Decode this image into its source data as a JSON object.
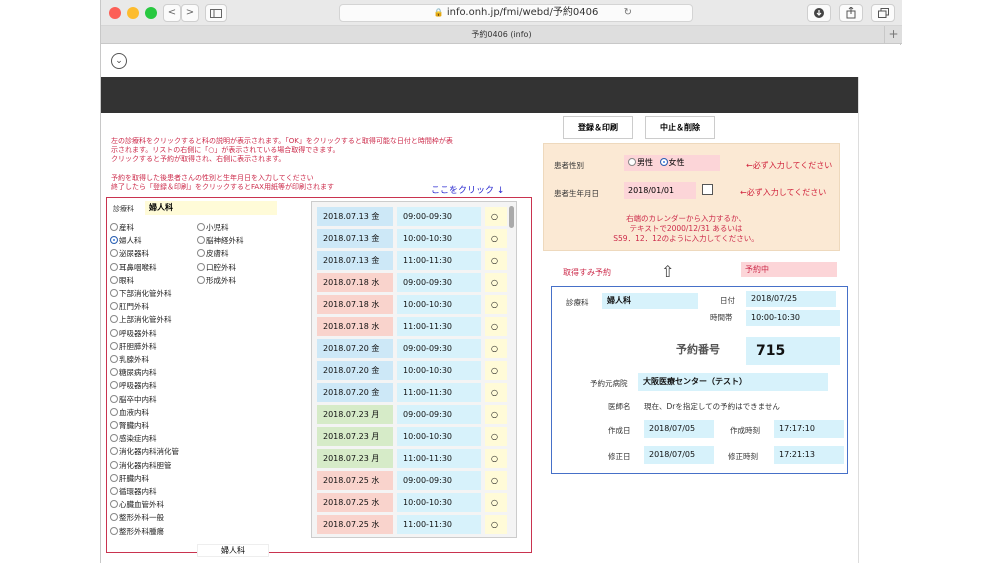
{
  "browser": {
    "url": "info.onh.jp/fmi/webd/予約0406",
    "tab_title": "予約0406 (info)",
    "back": "<",
    "forward": ">",
    "plus": "+"
  },
  "instructions": {
    "line1": "左の診療科をクリックすると科の説明が表示されます。「OK」をクリックすると取得可能な日付と時間枠が表",
    "line2": "示されます。リストの右側に「○」が表示されている場合取得できます。",
    "line3": "クリックすると予約が取得され、右側に表示されます。",
    "line4": "予約を取得した後患者さんの性別と生年月日を入力してください",
    "line5": "終了したら「登録＆印刷」をクリックするとFAX用紙等が印刷されます",
    "click_here": "ここをクリック ↓"
  },
  "department": {
    "label": "診療科",
    "value": "婦人科",
    "bottom_value": "婦人科",
    "col1": [
      "産科",
      "婦人科",
      "泌尿器科",
      "耳鼻咽喉科",
      "眼科",
      "下部消化管外科",
      "肛門外科",
      "上部消化管外科",
      "呼吸器外科",
      "肝胆膵外科",
      "乳腺外科",
      "糖尿病内科",
      "呼吸器内科",
      "脳卒中内科",
      "血液内科",
      "腎臓内科",
      "感染症内科",
      "消化器内科消化管",
      "消化器内科胆管",
      "肝臓内科",
      "循環器内科",
      "心臓血管外科",
      "整形外科一般",
      "整形外科腫瘍"
    ],
    "col2": [
      "小児科",
      "脳神経外科",
      "皮膚科",
      "口腔外科",
      "形成外科"
    ],
    "selected": "婦人科"
  },
  "schedule": [
    {
      "date": "2018.07.13 金",
      "time": "09:00-09:30",
      "mark": "○",
      "color": "#cde8f7"
    },
    {
      "date": "2018.07.13 金",
      "time": "10:00-10:30",
      "mark": "○",
      "color": "#cde8f7"
    },
    {
      "date": "2018.07.13 金",
      "time": "11:00-11:30",
      "mark": "○",
      "color": "#cde8f7"
    },
    {
      "date": "2018.07.18 水",
      "time": "09:00-09:30",
      "mark": "○",
      "color": "#f9d3cc"
    },
    {
      "date": "2018.07.18 水",
      "time": "10:00-10:30",
      "mark": "○",
      "color": "#f9d3cc"
    },
    {
      "date": "2018.07.18 水",
      "time": "11:00-11:30",
      "mark": "○",
      "color": "#f9d3cc"
    },
    {
      "date": "2018.07.20 金",
      "time": "09:00-09:30",
      "mark": "○",
      "color": "#cde8f7"
    },
    {
      "date": "2018.07.20 金",
      "time": "10:00-10:30",
      "mark": "○",
      "color": "#cde8f7"
    },
    {
      "date": "2018.07.20 金",
      "time": "11:00-11:30",
      "mark": "○",
      "color": "#cde8f7"
    },
    {
      "date": "2018.07.23 月",
      "time": "09:00-09:30",
      "mark": "○",
      "color": "#d6ebc8"
    },
    {
      "date": "2018.07.23 月",
      "time": "10:00-10:30",
      "mark": "○",
      "color": "#d6ebc8"
    },
    {
      "date": "2018.07.23 月",
      "time": "11:00-11:30",
      "mark": "○",
      "color": "#d6ebc8"
    },
    {
      "date": "2018.07.25 水",
      "time": "09:00-09:30",
      "mark": "○",
      "color": "#f9d3cc"
    },
    {
      "date": "2018.07.25 水",
      "time": "10:00-10:30",
      "mark": "○",
      "color": "#f9d3cc"
    },
    {
      "date": "2018.07.25 水",
      "time": "11:00-11:30",
      "mark": "○",
      "color": "#f9d3cc"
    }
  ],
  "buttons": {
    "register": "登録＆印刷",
    "cancel": "中止＆削除"
  },
  "patient": {
    "sex_label": "患者性別",
    "male": "男性",
    "female": "女性",
    "sex_required": "←必ず入力してください",
    "dob_label": "患者生年月日",
    "dob_value": "2018/01/01",
    "dob_required": "←必ず入力してください",
    "note1": "右端のカレンダーから入力するか、",
    "note2": "テキストで2000/12/31 あるいは",
    "note3": "S59．12．12のように入力してください。"
  },
  "booked": {
    "label": "取得すみ予約",
    "status": "予約中",
    "dept_label": "診療科",
    "dept_value": "婦人科",
    "date_label": "日付",
    "date_value": "2018/07/25",
    "slot_label": "時間帯",
    "slot_value": "10:00-10:30",
    "number_label": "予約番号",
    "number_value": "715",
    "hospital_label": "予約元病院",
    "hospital_value": "大阪医療センター（テスト）",
    "doctor_label": "医師名",
    "doctor_value": "現在、Drを指定しての予約はできません",
    "created_label": "作成日",
    "created_value": "2018/07/05",
    "created_time_label": "作成時刻",
    "created_time_value": "17:17:10",
    "modified_label": "修正日",
    "modified_value": "2018/07/05",
    "modified_time_label": "修正時刻",
    "modified_time_value": "17:21:13"
  }
}
